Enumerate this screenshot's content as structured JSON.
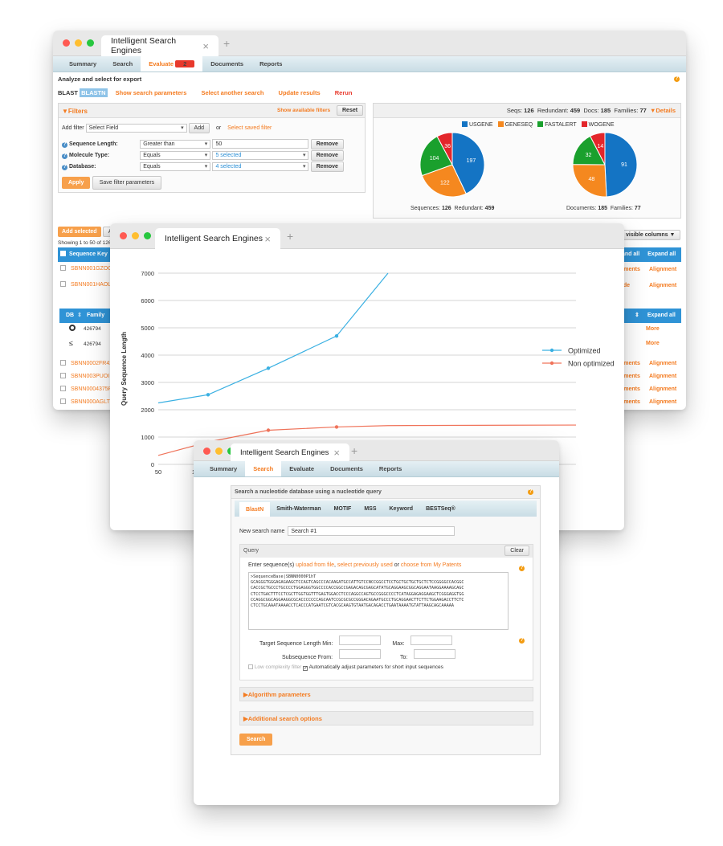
{
  "window1": {
    "tab_title": "Intelligent Search Engines",
    "nav": [
      "Summary",
      "Search",
      "Evaluate",
      "Documents",
      "Reports"
    ],
    "nav_badge": "2",
    "heading": "Analyze and select for export",
    "blast_label": "BLAST",
    "blastn_badge": "BLASTN",
    "links": [
      "Show search parameters",
      "Select another search",
      "Update results",
      "Rerun"
    ],
    "filters": {
      "title": "▼Filters",
      "show_available": "Show available filters",
      "reset": "Reset",
      "add_filter_label": "Add filter",
      "add_filter_select": "Select Field",
      "add_button": "Add",
      "or": "or",
      "select_saved": "Select saved filter",
      "rows": [
        {
          "label": "Sequence Length:",
          "op": "Greater than",
          "value": "50",
          "remove": "Remove"
        },
        {
          "label": "Molecule Type:",
          "op": "Equals",
          "value": "5 selected",
          "remove": "Remove"
        },
        {
          "label": "Database:",
          "op": "Equals",
          "value": "4 selected",
          "remove": "Remove"
        }
      ],
      "apply": "Apply",
      "save": "Save filter parameters"
    },
    "stats": {
      "seqs_label": "Seqs:",
      "seqs": "126",
      "redundant_label": "Redundant:",
      "redundant": "459",
      "docs_label": "Docs:",
      "docs": "185",
      "families_label": "Families:",
      "families": "77",
      "details": "▼Details"
    },
    "legend": [
      {
        "name": "USGENE",
        "color": "#1474c4"
      },
      {
        "name": "GENESEQ",
        "color": "#f5881f"
      },
      {
        "name": "FASTALERT",
        "color": "#1aa02d"
      },
      {
        "name": "WOGENE",
        "color": "#e3262b"
      }
    ],
    "pie1": {
      "values": [
        197,
        122,
        104,
        36
      ],
      "caption_a": "Sequences:",
      "caption_a_val": "126",
      "caption_b": "Redundant:",
      "caption_b_val": "459"
    },
    "pie2": {
      "values": [
        91,
        48,
        32,
        14
      ],
      "caption_a": "Documents:",
      "caption_a_val": "185",
      "caption_b": "Families:",
      "caption_b_val": "77"
    },
    "add_selected": "Add selected",
    "add_partial": "Add",
    "showing": "Showing 1 to 50 of 126 e",
    "visible_columns": "visible columns ▼",
    "table_header_left": "Sequence Key",
    "header_expand": "and all",
    "expand_all": "Expand all",
    "rows_left": [
      "SBNN001GZOO",
      "SBNN001HAOL"
    ],
    "rows_right": [
      [
        "uments",
        "Alignment"
      ],
      [
        "lide",
        "Alignment"
      ]
    ],
    "family_header": [
      "DB",
      "Family"
    ],
    "family_rows": [
      "426794",
      "426794"
    ],
    "family_right_header": "Expand all",
    "more": "More",
    "rows2_left": [
      "SBNN0002FR42",
      "SBNN003PUOI",
      "SBNN0004375R",
      "SBNN000AGLT"
    ],
    "rows2_right": [
      "uments",
      "Alignment"
    ]
  },
  "window2": {
    "tab_title": "Intelligent Search Engines",
    "chart_data": {
      "type": "line",
      "ylabel": "Query Sequence Length",
      "ylim": [
        0,
        7000
      ],
      "yticks": [
        0,
        1000,
        2000,
        3000,
        4000,
        5000,
        6000,
        7000
      ],
      "xticks_visible": [
        "50",
        "1"
      ],
      "series": [
        {
          "name": "Optimized",
          "color": "#3ab0e2",
          "values": [
            2250,
            2550,
            3520,
            4700,
            7000
          ]
        },
        {
          "name": "Non optimized",
          "color": "#f0735a",
          "values": [
            330,
            820,
            1250,
            1370,
            1420
          ]
        }
      ]
    }
  },
  "window3": {
    "tab_title": "Intelligent Search Engines",
    "nav": [
      "Summary",
      "Search",
      "Evaluate",
      "Documents",
      "Reports"
    ],
    "panel_title": "Search a nucleotide database using a nucleotide query",
    "tabs": [
      "BlastN",
      "Smith-Waterman",
      "MOTIF",
      "MSS",
      "Keyword",
      "BESTSeq®"
    ],
    "new_search_label": "New search name",
    "new_search_value": "Search #1",
    "query_label": "Query",
    "clear": "Clear",
    "enter_seq": "Enter sequence(s)",
    "upload": "upload from file",
    "select_prev": "select previously used",
    "or": "or",
    "choose": "choose from My Patents",
    "sequence_text": ">SequenceBase|SBNN0000P1hT\nGCAGGGTGGGAGAGAAGCTCCAGTCAGCCCACAAGATGCCATTGTCCNCCGGCCTCCTGCTGCTGCTGCTCTCCGGGGCCACGGC\nCACCGCTGCCCTGCCCCTGGAGGGTGGCCCCACCGGCCGAGACAGCGAGCATATGCAGGAAGCGGCAGGAATAAGGAAAAGCAGC\nCTCCTGACTTTCCTCGCTTGGTGGTTTGAGTGGACCTCCCAGGCCAGTGCCGGGCCCCTCATAGGAGAGGAAGCTCGGGAGGTGG\nCCAGGCGGCAGGAAGGCGCACCCCCCCAGCAATCCGCGCGCCGGGACAGAATGCCCTGCAGGAACTTCTTCTGGAAGACCTTCTC\nCTCCTGCAAATAAAACCTCACCCATGAATCGTCACGCAAGTGTAATGACAGACCTGAATAAAATGTATTAAGCAGCAAAAA",
    "target_min_label": "Target Sequence Length Min:",
    "max_label": "Max:",
    "subseq_label": "Subsequence From:",
    "to_label": "To:",
    "low_complexity": "Low complexity filter",
    "auto_adjust": "Automatically adjust parameters for short input sequences",
    "algorithm": "▶Algorithm parameters",
    "additional": "▶Additional search options",
    "search_button": "Search"
  }
}
